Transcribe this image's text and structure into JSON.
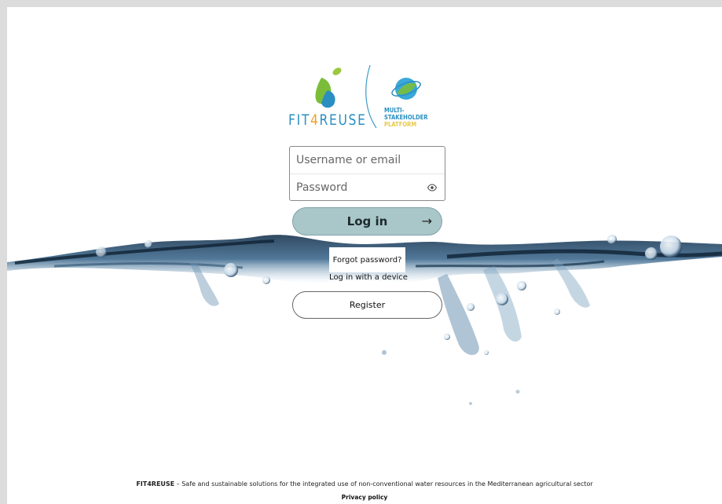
{
  "logo": {
    "brand_prefix": "FIT",
    "brand_four": "4",
    "brand_suffix": "REUSE",
    "platform_line1": "MULTI-STAKEHOLDER",
    "platform_line2": "PLATFORM"
  },
  "form": {
    "username_placeholder": "Username or email",
    "password_placeholder": "Password",
    "login_label": "Log in",
    "login_arrow": "→",
    "forgot_label": "Forgot password?",
    "device_label": "Log in with a device",
    "register_label": "Register"
  },
  "footer": {
    "brand": "FIT4REUSE",
    "description": " – Safe and sustainable solutions for the integrated use of non-conventional water resources in the Mediterranean agricultural sector",
    "privacy": "Privacy policy"
  },
  "colors": {
    "background": "#ffffff",
    "frame": "#dcdcdc",
    "login_button": "#a9c6c9",
    "brand_blue": "#2a8fc0",
    "brand_orange": "#f0a020",
    "brand_green": "#7bbd3a"
  },
  "icons": {
    "password_toggle": "eye-icon",
    "login_arrow": "arrow-right-icon"
  }
}
